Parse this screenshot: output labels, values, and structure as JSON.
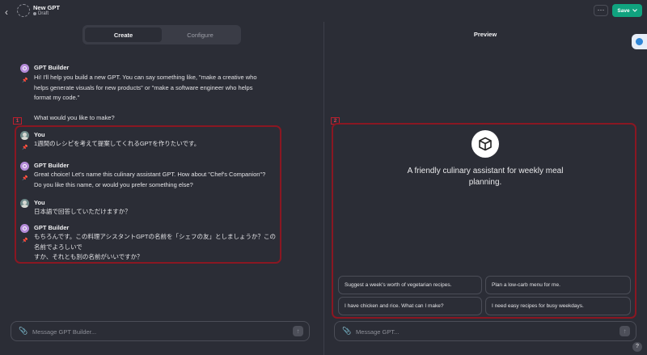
{
  "header": {
    "back_icon": "chevron-left-icon",
    "title": "New GPT",
    "status": "Draft",
    "more_label": "···",
    "save_label": "Save",
    "save_color": "#10a37f"
  },
  "tabs": [
    {
      "label": "Create",
      "active": true
    },
    {
      "label": "Configure",
      "active": false
    }
  ],
  "preview": {
    "title": "Preview",
    "description": "A friendly culinary assistant for weekly meal planning.",
    "starters": [
      "Suggest a week's worth of vegetarian recipes.",
      "Plan a low-carb menu for me.",
      "I have chicken and rice. What can I make?",
      "I need easy recipes for busy weekdays."
    ],
    "input_placeholder": "Message GPT..."
  },
  "chat": {
    "messages": [
      {
        "sender": "GPT Builder",
        "lines": [
          "Hi! I'll help you build a new GPT. You can say something like, \"make a creative who",
          "helps generate visuals for new products\" or \"make a software engineer who helps",
          "format my code.\""
        ],
        "extra": "What would you like to make?"
      },
      {
        "sender": "You",
        "lines": [
          "1週間のレシピを考えて提案してくれるGPTを作りたいです。"
        ]
      },
      {
        "sender": "GPT Builder",
        "lines": [
          "Great choice! Let's name this culinary assistant GPT. How about \"Chef's Companion\"?",
          "Do you like this name, or would you prefer something else?"
        ]
      },
      {
        "sender": "You",
        "lines": [
          "日本語で回答していただけますか？"
        ]
      },
      {
        "sender": "GPT Builder",
        "lines": [
          "もちろんです。この料理アシスタントGPTの名前を「シェフの友」としましょうか？この名前でよろしいで",
          "すか、それとも別の名前がいいですか？"
        ]
      }
    ],
    "input_placeholder": "Message GPT Builder..."
  },
  "annotations": {
    "marker_1": "1",
    "marker_2": "2",
    "color": "#8a1722"
  },
  "help_label": "?"
}
